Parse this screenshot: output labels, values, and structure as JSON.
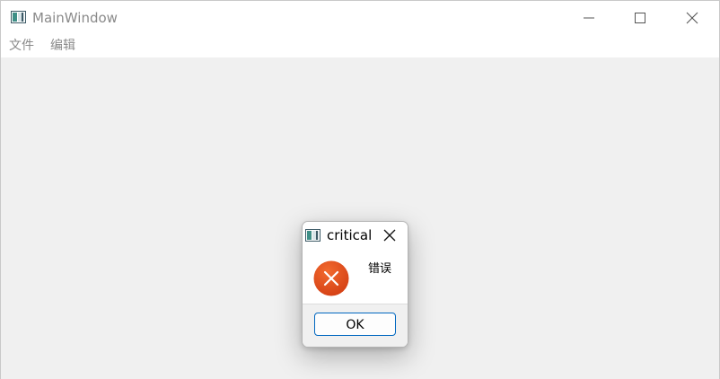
{
  "window": {
    "title": "MainWindow",
    "icon": "app-window-icon",
    "controls": {
      "minimize_icon": "minimize-icon",
      "maximize_icon": "maximize-icon",
      "close_icon": "close-icon"
    }
  },
  "menubar": {
    "items": [
      {
        "label": "文件"
      },
      {
        "label": "编辑"
      }
    ]
  },
  "dialog": {
    "title": "critical",
    "icon": "app-window-icon",
    "close_icon": "close-icon",
    "status_icon": "error-icon",
    "message": "错误",
    "ok_label": "OK",
    "colors": {
      "error_red": "#e04a1b",
      "accent_border": "#0067c0"
    }
  }
}
